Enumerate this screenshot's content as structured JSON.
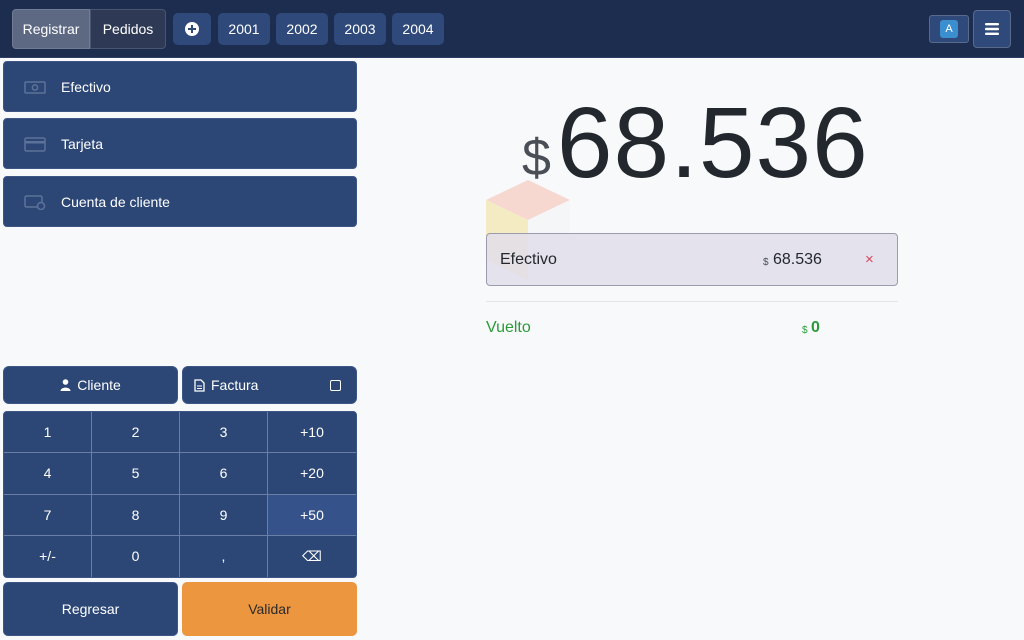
{
  "topbar": {
    "tab_register": "Registrar",
    "tab_orders": "Pedidos",
    "orders": [
      "2001",
      "2002",
      "2003",
      "2004"
    ],
    "user_initial": "A"
  },
  "payment_methods": [
    {
      "label": "Efectivo",
      "icon": "cash-icon"
    },
    {
      "label": "Tarjeta",
      "icon": "card-icon"
    },
    {
      "label": "Cuenta de cliente",
      "icon": "customer-account-icon"
    }
  ],
  "actions": {
    "customer": "Cliente",
    "invoice": "Factura",
    "invoice_checked": false,
    "back": "Regresar",
    "validate": "Validar"
  },
  "numpad": [
    "1",
    "2",
    "3",
    "+10",
    "4",
    "5",
    "6",
    "+20",
    "7",
    "8",
    "9",
    "+50",
    "+/-",
    "0",
    ",",
    "⌫"
  ],
  "summary": {
    "currency": "$",
    "total": "68.536",
    "payment_line": {
      "method": "Efectivo",
      "currency": "$",
      "amount": "68.536",
      "remove": "×"
    },
    "change_label": "Vuelto",
    "change_currency": "$",
    "change_amount": "0"
  },
  "colors": {
    "topbar": "#1d2d4f",
    "primary_button": "#2c4775",
    "validate": "#ec963f",
    "change": "#2b9a3a",
    "remove": "#d9485a"
  }
}
